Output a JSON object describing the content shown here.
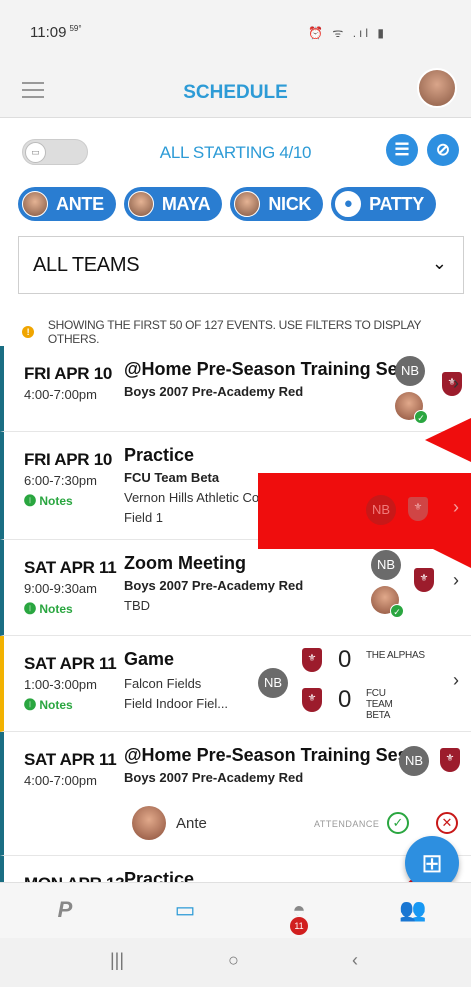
{
  "status_bar": {
    "time": "11:09",
    "temp": "59°",
    "icons": "⏰ ᯤ .ıl ▮"
  },
  "header": {
    "title": "SCHEDULE"
  },
  "filters": {
    "starting_label": "ALL STARTING 4/10",
    "people": [
      {
        "label": "ANTE"
      },
      {
        "label": "MAYA"
      },
      {
        "label": "NICK"
      },
      {
        "label": "PATTY"
      }
    ],
    "team_select": "ALL TEAMS"
  },
  "notice": "SHOWING THE FIRST 50 OF 127 EVENTS. USE FILTERS TO DISPLAY OTHERS.",
  "events": [
    {
      "date": "FRI APR 10",
      "time": "4:00-7:00pm",
      "title": "@Home Pre-Season Training Sess",
      "team": "Boys 2007 Pre-Academy Red",
      "badge": "NB"
    },
    {
      "date": "FRI APR 10",
      "time": "6:00-7:30pm",
      "notes": "Notes",
      "title": "Practice",
      "team": "FCU Team Beta",
      "location": "Vernon Hills Athletic Complex",
      "field": "Field 1",
      "badge": "NB"
    },
    {
      "date": "SAT APR 11",
      "time": "9:00-9:30am",
      "notes": "Notes",
      "title": "Zoom Meeting",
      "team": "Boys 2007 Pre-Academy Red",
      "location": "TBD",
      "badge": "NB"
    },
    {
      "date": "SAT APR 11",
      "time": "1:00-3:00pm",
      "notes": "Notes",
      "title": "Game",
      "location": "Falcon Fields",
      "field": "Field Indoor Fiel...",
      "badge": "NB",
      "home_score": "0",
      "away_score": "0",
      "home_team": "THE ALPHAS",
      "away_team": "FCU TEAM BETA"
    },
    {
      "date": "SAT APR 11",
      "time": "4:00-7:00pm",
      "title": "@Home Pre-Season Training Sess",
      "team": "Boys 2007 Pre-Academy Red",
      "badge": "NB",
      "attendee": "Ante",
      "attendance_label": "ATTENDANCE"
    },
    {
      "date": "MON APR 13",
      "title": "Practice"
    }
  ],
  "tabbar": {
    "badge_count": "11"
  },
  "colors": {
    "accent": "#2d9bd6",
    "chip": "#2a7dd1",
    "annotation_red": "#ef0d0d",
    "notes_green": "#2aa640"
  },
  "icons": [
    "hamburger-icon",
    "calendar-toggle-icon",
    "filter-icon",
    "link-icon",
    "chevron-down-icon",
    "chevron-right-icon",
    "team-shield-icon",
    "add-event-icon",
    "playmetrics-icon",
    "calendar-icon",
    "messages-icon",
    "people-icon"
  ]
}
